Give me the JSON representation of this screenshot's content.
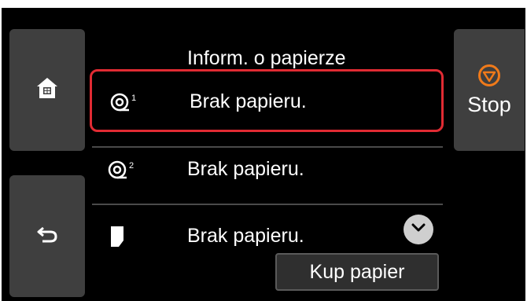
{
  "header": {
    "title": "Inform. o papierze"
  },
  "side": {
    "stop_label": "Stop"
  },
  "rows": [
    {
      "icon": "roll-1-icon",
      "label": "Brak papieru.",
      "selected": true
    },
    {
      "icon": "roll-2-icon",
      "label": "Brak papieru.",
      "selected": false
    },
    {
      "icon": "sheet-icon",
      "label": "Brak papieru.",
      "selected": false
    }
  ],
  "buttons": {
    "buy_label": "Kup papier"
  },
  "colors": {
    "selection": "#e12b33",
    "stop_icon": "#f07a1a",
    "button_bg": "#3f3f3f",
    "screen_bg": "#000000"
  }
}
